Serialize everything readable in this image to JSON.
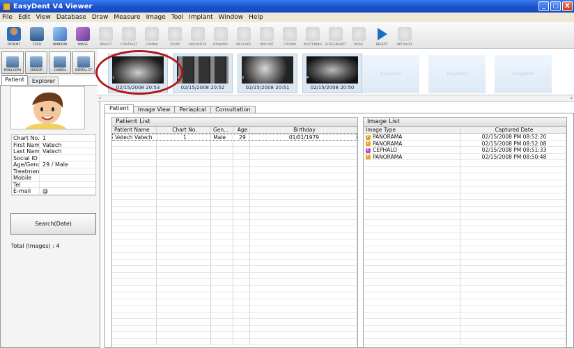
{
  "window": {
    "title": "EasyDent V4 Viewer",
    "buttons": {
      "min": "_",
      "max": "□",
      "close": "X"
    }
  },
  "menu": [
    "File",
    "Edit",
    "View",
    "Database",
    "Draw",
    "Measure",
    "Image",
    "Tool",
    "Implant",
    "Window",
    "Help"
  ],
  "toolbar": [
    {
      "label": "PATIENT",
      "icon": "patient-icon"
    },
    {
      "label": "TSFD",
      "icon": "tsfd-icon"
    },
    {
      "label": "WINDOW",
      "icon": "window-icon"
    },
    {
      "label": "IMAGE",
      "icon": "image-icon"
    },
    {
      "label": "BRIGHT",
      "icon": "bright-icon"
    },
    {
      "label": "CONTRAST",
      "icon": "contrast-icon"
    },
    {
      "label": "GAMMA",
      "icon": "gamma-icon"
    },
    {
      "label": "ZOOM",
      "icon": "zoom-icon"
    },
    {
      "label": "MAGNIFIER",
      "icon": "magnifier-icon"
    },
    {
      "label": "DRAWING",
      "icon": "drawing-icon"
    },
    {
      "label": "MEASURE",
      "icon": "measure-icon"
    },
    {
      "label": "IMPLANT",
      "icon": "implant-icon"
    },
    {
      "label": "CROWN",
      "icon": "crown-icon"
    },
    {
      "label": "WHITENING",
      "icon": "whitening-icon"
    },
    {
      "label": "SCREENSHOT",
      "icon": "screenshot-icon"
    },
    {
      "label": "MOVE",
      "icon": "move-icon"
    },
    {
      "label": "SELECT",
      "icon": "select-icon"
    },
    {
      "label": "INITIALIZE",
      "icon": "initialize-icon"
    }
  ],
  "acquisition": [
    {
      "label": "PANO/CEPH",
      "icon": "pano-ceph-icon"
    },
    {
      "label": "SENSOR",
      "icon": "sensor-icon"
    },
    {
      "label": "CAMERA",
      "icon": "camera-icon"
    },
    {
      "label": "DENTAL CT",
      "icon": "dental-ct-icon"
    }
  ],
  "left_tabs": [
    "Patient",
    "Explorer"
  ],
  "patient_info": [
    {
      "key": "Chart No.",
      "value": "1"
    },
    {
      "key": "First Name",
      "value": "Vatech"
    },
    {
      "key": "Last Name",
      "value": "Vatech"
    },
    {
      "key": "Social ID",
      "value": ""
    },
    {
      "key": "Age/Gender",
      "value": "29 / Male"
    },
    {
      "key": "Treatment",
      "value": ""
    },
    {
      "key": "Mobile",
      "value": ""
    },
    {
      "key": "Tel",
      "value": ""
    },
    {
      "key": "E-mail",
      "value": "@"
    }
  ],
  "search_button": "Search(Date)",
  "total_images": "Total (Images) : 4",
  "thumbnails": [
    {
      "caption": "02/15/2008 20:53",
      "index": "1"
    },
    {
      "caption": "02/15/2008 20:52",
      "index": "2"
    },
    {
      "caption": "02/15/2008 20:51",
      "index": "3"
    },
    {
      "caption": "02/15/2008 20:50",
      "index": "4"
    }
  ],
  "ghost_label": "EasyDent",
  "main_tabs": [
    "Patient",
    "Image View",
    "Periapical",
    "Consultation"
  ],
  "patient_list": {
    "title": "Patient List",
    "columns": [
      "Patient Name",
      "Chart No.",
      "Gen...",
      "Age",
      "Birthday"
    ],
    "rows": [
      [
        "Vatech Vatech",
        "1",
        "Male",
        "29",
        "01/01/1979"
      ]
    ]
  },
  "image_list": {
    "title": "Image List",
    "columns": [
      "Image Type",
      "Captured Date"
    ],
    "rows": [
      {
        "type": "PANORAMA",
        "badge": "P",
        "date": "02/15/2008 PM 08:52:20"
      },
      {
        "type": "PANORAMA",
        "badge": "P",
        "date": "02/15/2008 PM 08:52:08"
      },
      {
        "type": "CEPHALO",
        "badge": "C",
        "date": "02/15/2008 PM 08:51:33"
      },
      {
        "type": "PANORAMA",
        "badge": "P",
        "date": "02/15/2008 PM 08:50:48"
      }
    ]
  },
  "colors": {
    "title_bar": "#1c55d0",
    "highlight_circle": "#b0171d",
    "badge_p": "#e8a020",
    "badge_c": "#b04cc8"
  }
}
